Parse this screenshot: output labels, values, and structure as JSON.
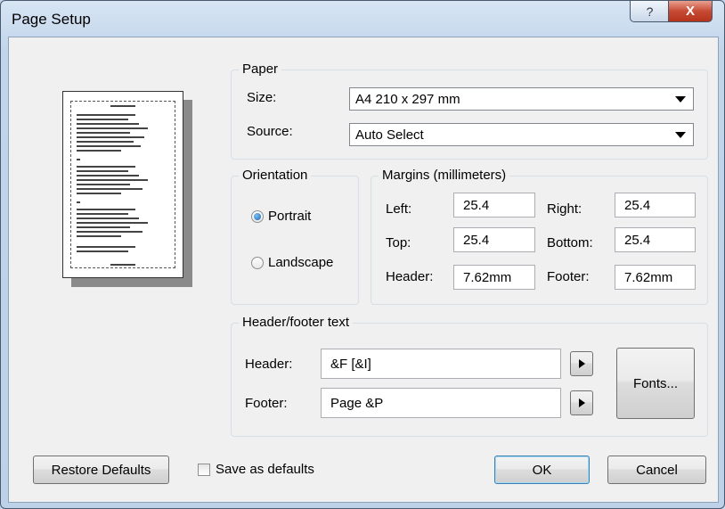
{
  "window": {
    "title": "Page Setup",
    "help_glyph": "?",
    "close_glyph": "X"
  },
  "paper": {
    "legend": "Paper",
    "size_label": "Size:",
    "size_value": "A4 210 x 297 mm",
    "source_label": "Source:",
    "source_value": "Auto Select"
  },
  "orientation": {
    "legend": "Orientation",
    "portrait_label": "Portrait",
    "landscape_label": "Landscape",
    "selected": "Portrait"
  },
  "margins": {
    "legend": "Margins (millimeters)",
    "left_label": "Left:",
    "left_value": "25.4",
    "right_label": "Right:",
    "right_value": "25.4",
    "top_label": "Top:",
    "top_value": "25.4",
    "bottom_label": "Bottom:",
    "bottom_value": "25.4",
    "header_label": "Header:",
    "header_value": "7.62mm",
    "footer_label": "Footer:",
    "footer_value": "7.62mm"
  },
  "header_footer": {
    "legend": "Header/footer text",
    "header_label": "Header:",
    "header_value": "&F [&I]",
    "footer_label": "Footer:",
    "footer_value": "Page &P",
    "fonts_button": "Fonts..."
  },
  "bottom": {
    "restore_defaults": "Restore Defaults",
    "save_as_defaults": "Save as defaults",
    "save_as_defaults_checked": false,
    "ok": "OK",
    "cancel": "Cancel"
  },
  "icons": {
    "radio_selected": "radio-selected-icon",
    "dropdown": "chevron-down-icon",
    "insert_field": "play-triangle-icon"
  }
}
